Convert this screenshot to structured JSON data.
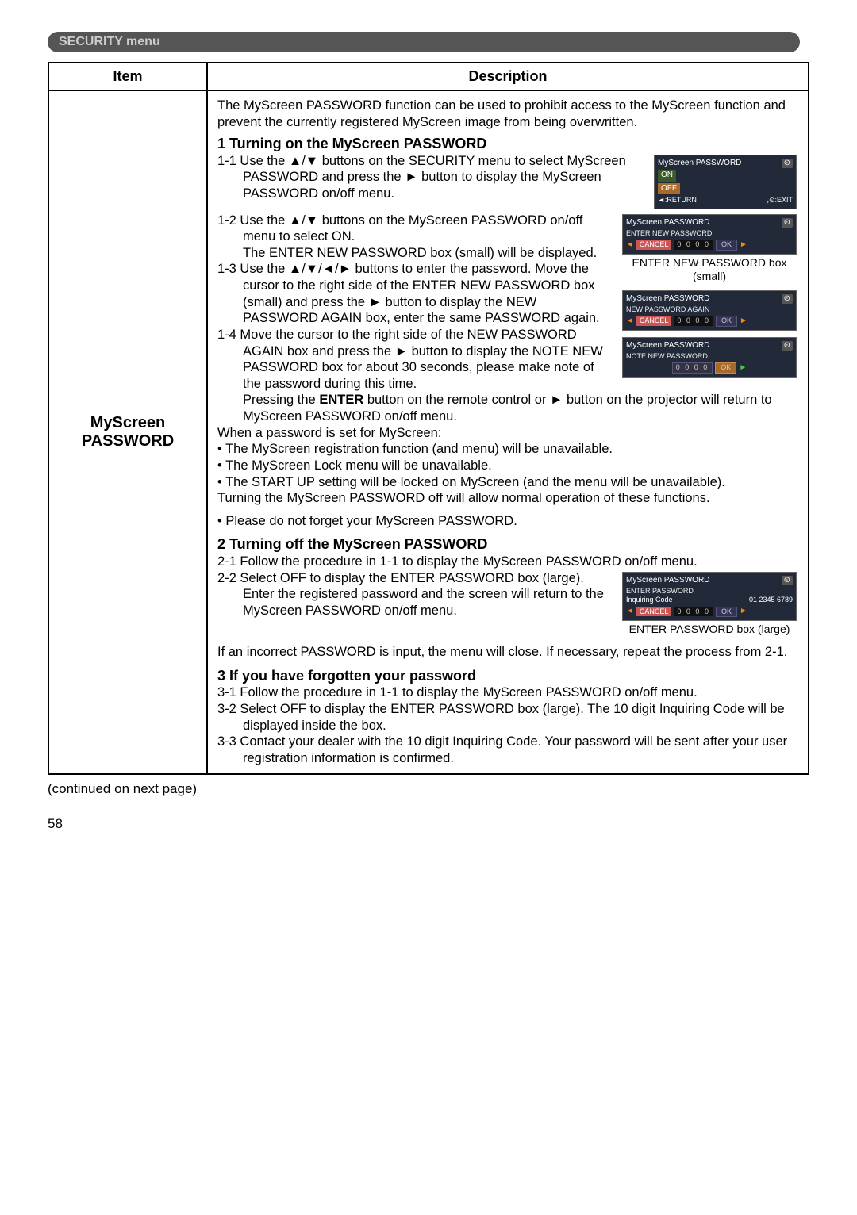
{
  "menu_header": "SECURITY menu",
  "table": {
    "header_item": "Item",
    "header_desc": "Description",
    "item": "MyScreen PASSWORD",
    "intro": "The MyScreen PASSWORD function can be used to prohibit access to the MyScreen function and prevent the currently registered MyScreen image from being overwritten.",
    "section1": {
      "heading": "1 Turning on the MyScreen PASSWORD",
      "s1_1": "1-1 Use the ▲/▼ buttons on the SECURITY menu to select MyScreen PASSWORD and press the ► button to display the MyScreen PASSWORD on/off menu.",
      "s1_2_a": "1-2 Use the ▲/▼ buttons on the MyScreen PASSWORD on/off menu to select ON.",
      "s1_2_b": "The ENTER NEW PASSWORD box (small) will be displayed.",
      "s1_3": "1-3 Use the ▲/▼/◄/► buttons to enter the password. Move the cursor to the right side of the ENTER NEW PASSWORD box (small) and press the ► button to display the NEW PASSWORD AGAIN box, enter the same PASSWORD again.",
      "s1_4": "1-4 Move the cursor to the right side of the NEW PASSWORD AGAIN box and press the ► button to display the NOTE NEW PASSWORD box for about 30 seconds, please make note of the password during this time.",
      "s1_press": "Pressing the ENTER button on the remote control or ► button on the projector will return to MyScreen PASSWORD on/off menu.",
      "s1_press_enter": "ENTER",
      "when_set": "When a password is set for MyScreen:",
      "b1": "• The MyScreen registration function (and menu) will be unavailable.",
      "b2": "• The MyScreen Lock menu will be unavailable.",
      "b3": "• The START UP setting will be locked on MyScreen (and the menu will be unavailable).",
      "off_normal": "Turning the MyScreen PASSWORD off will allow normal operation of these functions.",
      "note": "• Please do not forget your MyScreen PASSWORD."
    },
    "section2": {
      "heading": "2 Turning off the MyScreen PASSWORD",
      "s2_1": "2-1 Follow the procedure in 1-1 to display the MyScreen PASSWORD on/off menu.",
      "s2_2": "2-2 Select OFF to display the ENTER PASSWORD box (large). Enter the registered password and the screen will return to the MyScreen PASSWORD on/off menu.",
      "incorrect": "If an incorrect PASSWORD is input, the menu will close. If necessary, repeat the process from 2-1."
    },
    "section3": {
      "heading": "3 If you have forgotten your password",
      "s3_1": "3-1 Follow the procedure in 1-1 to display the MyScreen PASSWORD on/off menu.",
      "s3_2": "3-2 Select OFF to display the ENTER PASSWORD box (large). The 10 digit Inquiring Code will be displayed inside the box.",
      "s3_3": "3-3 Contact your dealer with the 10 digit Inquiring Code. Your password will be sent after your user registration information is confirmed."
    }
  },
  "dialogs": {
    "d1": {
      "title": "MyScreen PASSWORD",
      "on": "ON",
      "off": "OFF",
      "return": "◄:RETURN",
      "exit": ",⊙:EXIT"
    },
    "d2": {
      "title": "MyScreen PASSWORD",
      "sub": "ENTER NEW PASSWORD",
      "cancel": "CANCEL",
      "digits": "0 0 0 0",
      "ok": "OK",
      "caption": "ENTER NEW PASSWORD box (small)"
    },
    "d3": {
      "title": "MyScreen PASSWORD",
      "sub": "NEW PASSWORD AGAIN",
      "cancel": "CANCEL",
      "digits": "0 0 0 0",
      "ok": "OK"
    },
    "d4": {
      "title": "MyScreen PASSWORD",
      "sub": "NOTE NEW PASSWORD",
      "digits": "0 0 0 0",
      "ok": "OK"
    },
    "d5": {
      "title": "MyScreen PASSWORD",
      "sub": "ENTER PASSWORD",
      "inq": "Inquiring Code",
      "inq_code": "01 2345 6789",
      "cancel": "CANCEL",
      "digits": "0 0 0 0",
      "ok": "OK",
      "caption": "ENTER PASSWORD box (large)"
    }
  },
  "continued": "(continued on next page)",
  "page_number": "58"
}
